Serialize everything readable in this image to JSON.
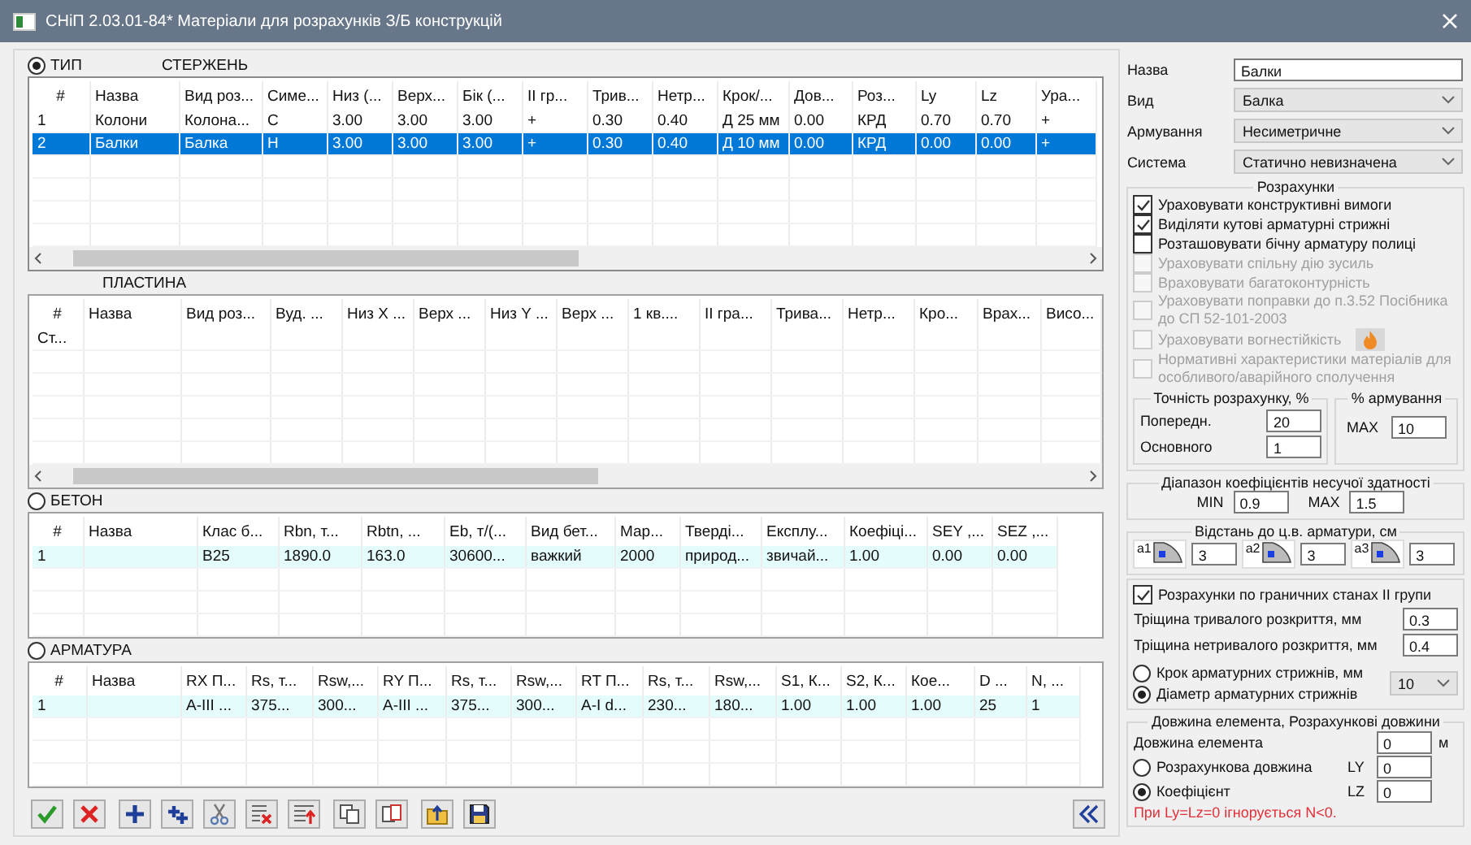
{
  "window": {
    "title": "СНіП 2.03.01-84*  Матеріали для розрахунків З/Б конструкцій"
  },
  "tables": [
    {
      "radio": {
        "label": "ТИП",
        "selected": true
      },
      "caption": "СТЕРЖЕНЬ",
      "focused": true,
      "columns": [
        "#",
        "Назва",
        "Вид роз...",
        "Симе...",
        "Низ (...",
        "Верх...",
        "Бік (...",
        "II гр...",
        "Трив...",
        "Нетр...",
        "Крок/...",
        "Дов...",
        "Роз...",
        "Ly",
        "Lz",
        "Ура..."
      ],
      "rows": [
        {
          "cells": [
            "1",
            "Колони",
            "Колона...",
            "С",
            "3.00",
            "3.00",
            "3.00",
            "+",
            "0.30",
            "0.40",
            "Д 25 мм",
            "0.00",
            "КРД",
            "0.70",
            "0.70",
            "+"
          ],
          "selected": false
        },
        {
          "cells": [
            "2",
            "Балки",
            "Балка",
            "Н",
            "3.00",
            "3.00",
            "3.00",
            "+",
            "0.30",
            "0.40",
            "Д 10 мм",
            "0.00",
            "КРД",
            "0.00",
            "0.00",
            "+"
          ],
          "selected": true
        }
      ]
    },
    {
      "caption": "ПЛАСТИНА",
      "focused": false,
      "columns": [
        "#",
        "Назва",
        "Вид роз...",
        "Вуд. ...",
        "Низ X ...",
        "Верх ...",
        "Низ Y ...",
        "Верх ...",
        "1 кв....",
        "II гра...",
        "Трива...",
        "Нетр...",
        "Кро...",
        "Врах...",
        "Висо..."
      ],
      "rows": [
        {
          "cells": [
            "Ст..."
          ],
          "selected": false
        }
      ]
    },
    {
      "radio": {
        "label": "БЕТОН",
        "selected": false
      },
      "focused": false,
      "columns": [
        "#",
        "Назва",
        "Клас б...",
        "Rbn, т...",
        "Rbtn, ...",
        "Eb, т/(...",
        "Вид бет...",
        "Мар...",
        "Тверді...",
        "Експлу...",
        "Коефіці...",
        "SEY ,...",
        "SEZ ,..."
      ],
      "rows": [
        {
          "cells": [
            "1",
            null,
            "B25",
            "1890.0",
            "163.0",
            "30600...",
            "важкий",
            "2000",
            "природ...",
            "звичай...",
            "1.00",
            "0.00",
            "0.00"
          ],
          "selected": true
        }
      ]
    },
    {
      "radio": {
        "label": "АРМАТУРА",
        "selected": false
      },
      "focused": false,
      "columns": [
        "#",
        "Назва",
        "RX П...",
        "Rs, т...",
        "Rsw,...",
        "RY П...",
        "Rs, т...",
        "Rsw,...",
        "RT П...",
        "Rs, т...",
        "Rsw,...",
        "S1, К...",
        "S2, К...",
        "Кое...",
        "D ...",
        "N, ..."
      ],
      "rows": [
        {
          "cells": [
            "1",
            null,
            "A-III ...",
            "375...",
            "300...",
            "A-III ...",
            "375...",
            "300...",
            "A-I d...",
            "230...",
            "180...",
            "1.00",
            "1.00",
            "1.00",
            "25",
            "1"
          ],
          "selected": true
        }
      ]
    }
  ],
  "properties": [
    {
      "label": "Назва",
      "value": "Балки",
      "kind": "input"
    },
    {
      "label": "Вид",
      "value": "Балка",
      "kind": "select"
    },
    {
      "label": "Армування",
      "value": "Несиметричне",
      "kind": "select"
    },
    {
      "label": "Система",
      "value": "Статично невизначена",
      "kind": "select"
    }
  ],
  "calculations": {
    "title": "Розрахунки",
    "options": [
      {
        "label": "Ураховувати конструктивні вимоги",
        "checked": true,
        "disabled": false,
        "kind": "plain"
      },
      {
        "label": "Виділяти кутові арматурні стрижні",
        "checked": true,
        "disabled": false,
        "kind": "plain"
      },
      {
        "label": "Розташовувати бічну арматуру полиці",
        "checked": false,
        "disabled": false,
        "kind": "plain"
      },
      {
        "label": "Ураховувати спільну дію зусиль",
        "checked": false,
        "disabled": true,
        "kind": "plain"
      },
      {
        "label": "Враховувати багатоконтурність",
        "checked": false,
        "disabled": true,
        "kind": "plain"
      },
      {
        "label": "Ураховувати поправки до п.3.52 Посібника до СП 52-101-2003",
        "checked": false,
        "disabled": true,
        "kind": "plain"
      },
      {
        "label": "Ураховувати вогнестійкість",
        "checked": false,
        "disabled": true,
        "kind": "fire"
      },
      {
        "label": "Нормативні характеристики матеріалів для особливого/аварійного сполучення",
        "checked": false,
        "disabled": true,
        "kind": "plain"
      }
    ],
    "accuracy": {
      "title": "Точність розрахунку, %",
      "fields": [
        {
          "label": "Попередн.",
          "value": "20"
        },
        {
          "label": "Основного",
          "value": "1"
        }
      ]
    },
    "reinforcement": {
      "title": "% армування",
      "label": "MAX",
      "value": "10"
    }
  },
  "capacity": {
    "title": "Діапазон коефіцієнтів несучої здатності",
    "fields": [
      {
        "label": "MIN",
        "value": "0.9"
      },
      {
        "label": "MAX",
        "value": "1.5"
      }
    ]
  },
  "cover": {
    "title": "Відстань до ц.в. арматури, см",
    "items": [
      {
        "icon_label": "a1",
        "value": "3"
      },
      {
        "icon_label": "a2",
        "value": "3"
      },
      {
        "icon_label": "a3",
        "value": "3"
      }
    ]
  },
  "serviceability": {
    "label": "Розрахунки по граничних станах II групи",
    "checked": true,
    "fields": [
      {
        "label": "Тріщина тривалого розкриття, мм",
        "value": "0.3"
      },
      {
        "label": "Тріщина нетривалого розкриття, мм",
        "value": "0.4"
      }
    ],
    "options": [
      {
        "label": "Крок арматурних стрижнів, мм",
        "selected": false
      },
      {
        "label": "Діаметр арматурних стрижнів",
        "selected": true
      }
    ],
    "select": "10"
  },
  "lengths": {
    "title": "Довжина елемента, Розрахункові довжини",
    "length": {
      "label": "Довжина елемента",
      "value": "0",
      "unit": "м"
    },
    "options": [
      {
        "label": "Розрахункова довжина",
        "selected": false,
        "axis": "LY",
        "value": "0"
      },
      {
        "label": "Коефіцієнт",
        "selected": true,
        "axis": "LZ",
        "value": "0"
      }
    ],
    "note": "При Ly=Lz=0 ігнорується N<0."
  }
}
